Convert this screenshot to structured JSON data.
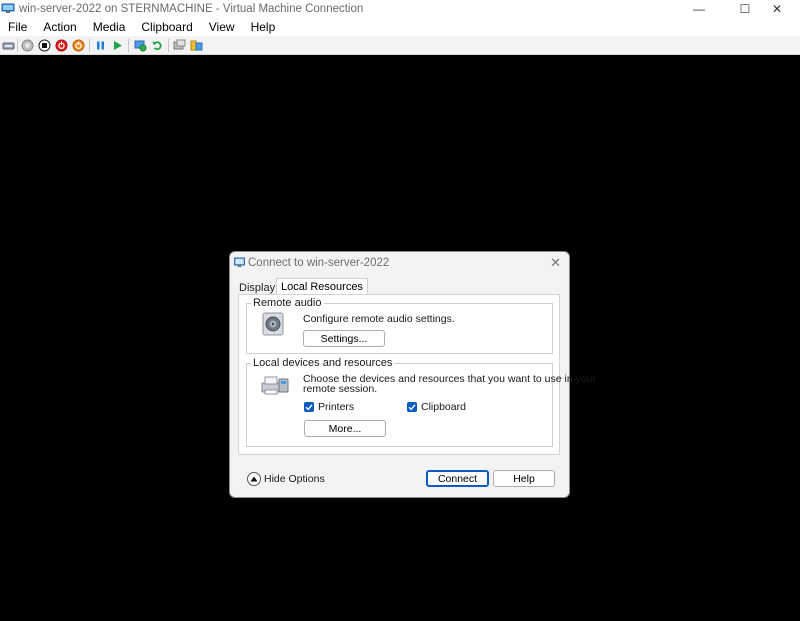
{
  "window": {
    "title": "win-server-2022 on STERNMACHINE - Virtual Machine Connection",
    "minimize": "—",
    "maximize": "☐",
    "close": "✕"
  },
  "menu": {
    "items": [
      "File",
      "Action",
      "Media",
      "Clipboard",
      "View",
      "Help"
    ]
  },
  "toolbar": {
    "icons": [
      "ctrl-alt-del-icon",
      "start-icon",
      "turn-off-icon",
      "shut-down-icon",
      "save-icon",
      "pause-icon",
      "resume-icon",
      "checkpoint-icon",
      "revert-icon",
      "enhanced-session-icon",
      "share-icon"
    ]
  },
  "dialog": {
    "title": "Connect to win-server-2022",
    "close": "✕",
    "tabs": [
      "Display",
      "Local Resources"
    ],
    "active_tab": "Local Resources",
    "remote_audio": {
      "label": "Remote audio",
      "description": "Configure remote audio settings.",
      "settings_button": "Settings..."
    },
    "local_devices": {
      "label": "Local devices and resources",
      "description_line1": "Choose the devices and resources that you want to use in your",
      "description_line2": "remote session.",
      "printers_label": "Printers",
      "printers_checked": true,
      "clipboard_label": "Clipboard",
      "clipboard_checked": true,
      "more_button": "More..."
    },
    "hide_options": "Hide Options",
    "connect_button": "Connect",
    "help_button": "Help"
  },
  "colors": {
    "accent": "#0a5bc4",
    "screen_background": "#000000"
  }
}
